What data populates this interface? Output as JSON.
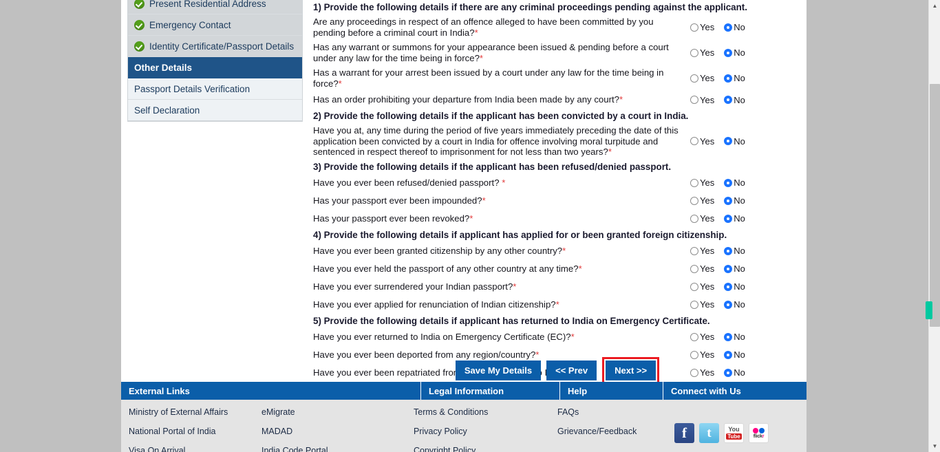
{
  "sidebar": {
    "items": [
      {
        "label": "Present Residential Address",
        "state": "done",
        "icon": "check-circle-icon"
      },
      {
        "label": "Emergency Contact",
        "state": "done",
        "icon": "check-circle-icon"
      },
      {
        "label": "Identity Certificate/Passport Details",
        "state": "done",
        "icon": "check-circle-icon"
      },
      {
        "label": "Other Details",
        "state": "active",
        "icon": ""
      },
      {
        "label": "Passport Details Verification",
        "state": "plain",
        "icon": ""
      },
      {
        "label": "Self Declaration",
        "state": "plain",
        "icon": ""
      }
    ]
  },
  "form": {
    "options": {
      "yes": "Yes",
      "no": "No"
    },
    "sections": [
      {
        "title": "1) Provide the following details if there are any criminal proceedings pending against the applicant.",
        "questions": [
          {
            "text": "Are any proceedings in respect of an offence alleged to have been committed by you pending before a criminal court in India?",
            "required": true,
            "value": "No"
          },
          {
            "text": "Has any warrant or summons for your appearance been issued & pending before a court under any law for the time being in force?",
            "required": true,
            "value": "No"
          },
          {
            "text": "Has a warrant for your arrest been issued by a court under any law for the time being in force?",
            "required": true,
            "value": "No"
          },
          {
            "text": "Has an order prohibiting your departure from India been made by any court?",
            "required": true,
            "value": "No"
          }
        ]
      },
      {
        "title": "2) Provide the following details if the applicant has been convicted by a court in India.",
        "questions": [
          {
            "text": "Have you at, any time during the period of five years immediately preceding the date of this application been convicted by a court in India for offence involving moral turpitude and sentenced in respect thereof to imprisonment for not less than two years?",
            "required": true,
            "value": "No"
          }
        ]
      },
      {
        "title": "3) Provide the following details if the applicant has been refused/denied passport.",
        "questions": [
          {
            "text": "Have you ever been refused/denied passport? ",
            "required": true,
            "value": "No"
          },
          {
            "text": "Has your passport ever been impounded?",
            "required": true,
            "value": "No"
          },
          {
            "text": "Has your passport ever been revoked?",
            "required": true,
            "value": "No"
          }
        ]
      },
      {
        "title": "4) Provide the following details if applicant has applied for or been granted foreign citizenship.",
        "questions": [
          {
            "text": "Have you ever been granted citizenship by any other country?",
            "required": true,
            "value": "No"
          },
          {
            "text": "Have you ever held the passport of any other country at any time?",
            "required": true,
            "value": "No"
          },
          {
            "text": "Have you ever surrendered your Indian passport?",
            "required": true,
            "value": "No"
          },
          {
            "text": "Have you ever applied for renunciation of Indian citizenship?",
            "required": true,
            "value": "No"
          }
        ]
      },
      {
        "title": "5) Provide the following details if applicant has returned to India on Emergency Certificate.",
        "questions": [
          {
            "text": "Have you ever returned to India on Emergency Certificate (EC)?",
            "required": true,
            "value": "No"
          },
          {
            "text": "Have you ever been deported from any region/country?",
            "required": true,
            "value": "No"
          },
          {
            "text": "Have you ever been repatriated from any country back to India?",
            "required": true,
            "value": "No"
          }
        ]
      }
    ]
  },
  "buttons": {
    "save": "Save My Details",
    "prev": "<< Prev",
    "next": "Next >>",
    "highlighted": "next"
  },
  "footer": {
    "headers": [
      "External Links",
      "Legal Information",
      "Help",
      "Connect with Us"
    ],
    "col_a": [
      "Ministry of External Affairs",
      "National Portal of India",
      "Visa On Arrival"
    ],
    "col_b": [
      "eMigrate",
      "MADAD",
      "India Code Portal"
    ],
    "col_c": [
      "Terms & Conditions",
      "Privacy Policy",
      "Copyright Policy"
    ],
    "col_d": [
      "FAQs",
      "Grievance/Feedback"
    ],
    "social": [
      {
        "name": "facebook-icon",
        "label": "f"
      },
      {
        "name": "twitter-icon",
        "label": "t"
      },
      {
        "name": "youtube-icon",
        "label": "You"
      },
      {
        "name": "flickr-icon",
        "label": "flickr"
      }
    ]
  },
  "colors": {
    "accent": "#0b5ea9",
    "sidebar_active": "#1f5488",
    "required": "#e23b3b",
    "highlight": "#ee1c22",
    "check": "#54a01b",
    "radio_selected": "#1a73ff",
    "find_marker": "#00c9a0"
  }
}
